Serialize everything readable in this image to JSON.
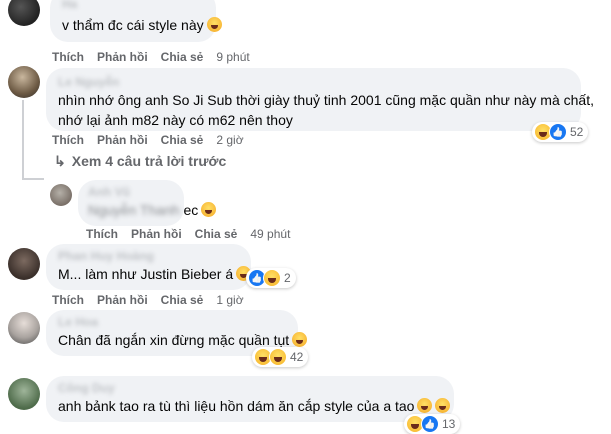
{
  "comments": [
    {
      "author": "Ha",
      "text": "v thẩm đc cái style này",
      "like_label": "Thích",
      "reply_label": "Phản hồi",
      "share_label": "Chia sẻ",
      "time": "9 phút"
    },
    {
      "author": "Le Nguyễn",
      "text_line1": "nhìn nhớ ông anh So Ji Sub thời giày thuỷ tinh 2001 cũng mặc quần như này mà chất,",
      "text_line2": "nhớ lại ảnh m82 này có m62 nên thoy",
      "like_label": "Thích",
      "reply_label": "Phản hồi",
      "share_label": "Chia sẻ",
      "time": "2 giờ",
      "reaction_count": "52"
    },
    {
      "author": "Phan Huy Hoàng",
      "text": "M... làm như Justin Bieber á",
      "like_label": "Thích",
      "reply_label": "Phản hồi",
      "share_label": "Chia sẻ",
      "time": "1 giờ",
      "reaction_count": "2"
    },
    {
      "author": "Le Hoa",
      "text": "Chân đã ngắn xin đừng mặc quần tụt",
      "like_label": "Thích",
      "reply_label": "Phản hồi",
      "share_label": "Chia sẻ",
      "reaction_count": "42"
    },
    {
      "author": "Công Duy",
      "text": "anh bảnk tao ra tù thì liệu hồn dám ăn cắp style của a tao",
      "like_label": "Thích",
      "reply_label": "Phản hồi",
      "share_label": "Chia sẻ",
      "reaction_count": "13"
    }
  ],
  "reply": {
    "author": "Anh Vũ",
    "text_prefix": "Nguyễn Thanh",
    "text_suffix": "ec",
    "like_label": "Thích",
    "reply_label": "Phản hồi",
    "share_label": "Chia sẻ",
    "time": "49 phút"
  },
  "view_more": "Xem 4 câu trả lời trước",
  "icons": [
    "haha-reaction",
    "like-reaction",
    "wow-reaction",
    "reply-arrow-icon"
  ]
}
